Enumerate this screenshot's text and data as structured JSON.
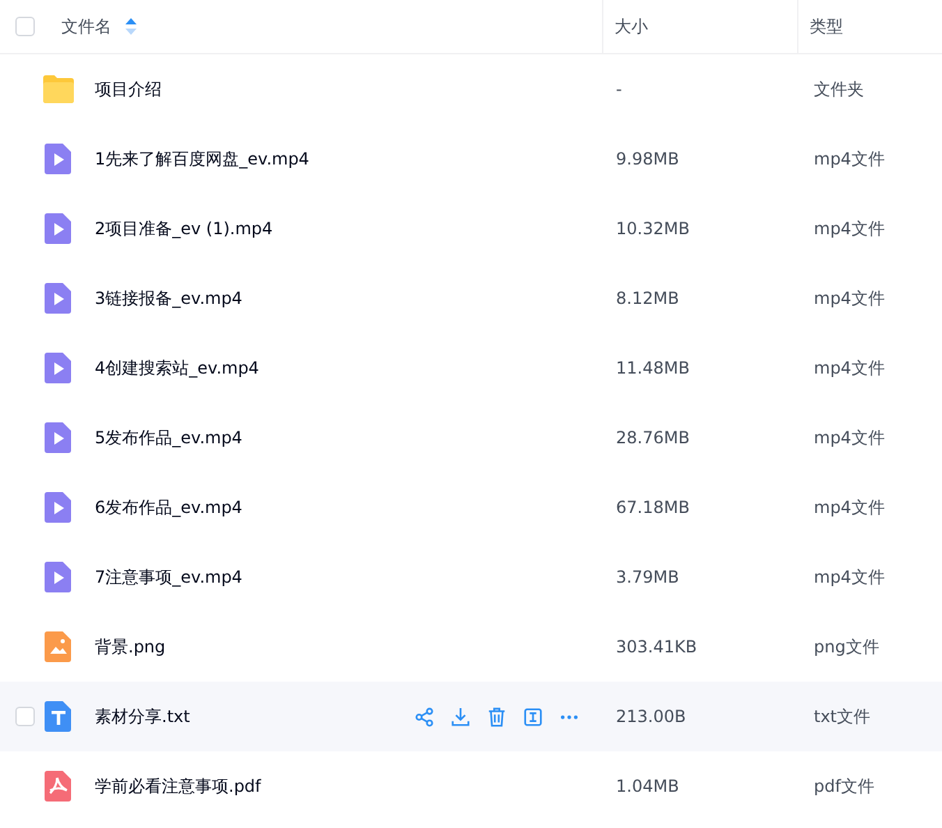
{
  "header": {
    "checked": false,
    "columns": [
      {
        "label": "文件名",
        "sorted": true
      },
      {
        "label": "大小",
        "sorted": false
      },
      {
        "label": "类型",
        "sorted": false
      }
    ]
  },
  "rows": [
    {
      "kind": "folder",
      "name": "项目介绍",
      "size": "-",
      "type": "文件夹",
      "hovered": false
    },
    {
      "kind": "video",
      "name": "1先来了解百度网盘_ev.mp4",
      "size": "9.98MB",
      "type": "mp4文件",
      "hovered": false
    },
    {
      "kind": "video",
      "name": "2项目准备_ev (1).mp4",
      "size": "10.32MB",
      "type": "mp4文件",
      "hovered": false
    },
    {
      "kind": "video",
      "name": "3链接报备_ev.mp4",
      "size": "8.12MB",
      "type": "mp4文件",
      "hovered": false
    },
    {
      "kind": "video",
      "name": "4创建搜索站_ev.mp4",
      "size": "11.48MB",
      "type": "mp4文件",
      "hovered": false
    },
    {
      "kind": "video",
      "name": "5发布作品_ev.mp4",
      "size": "28.76MB",
      "type": "mp4文件",
      "hovered": false
    },
    {
      "kind": "video",
      "name": "6发布作品_ev.mp4",
      "size": "67.18MB",
      "type": "mp4文件",
      "hovered": false
    },
    {
      "kind": "video",
      "name": "7注意事项_ev.mp4",
      "size": "3.79MB",
      "type": "mp4文件",
      "hovered": false
    },
    {
      "kind": "image",
      "name": "背景.png",
      "size": "303.41KB",
      "type": "png文件",
      "hovered": false
    },
    {
      "kind": "text",
      "name": "素材分享.txt",
      "size": "213.00B",
      "type": "txt文件",
      "hovered": true
    },
    {
      "kind": "pdf",
      "name": "学前必看注意事项.pdf",
      "size": "1.04MB",
      "type": "pdf文件",
      "hovered": false
    }
  ]
}
